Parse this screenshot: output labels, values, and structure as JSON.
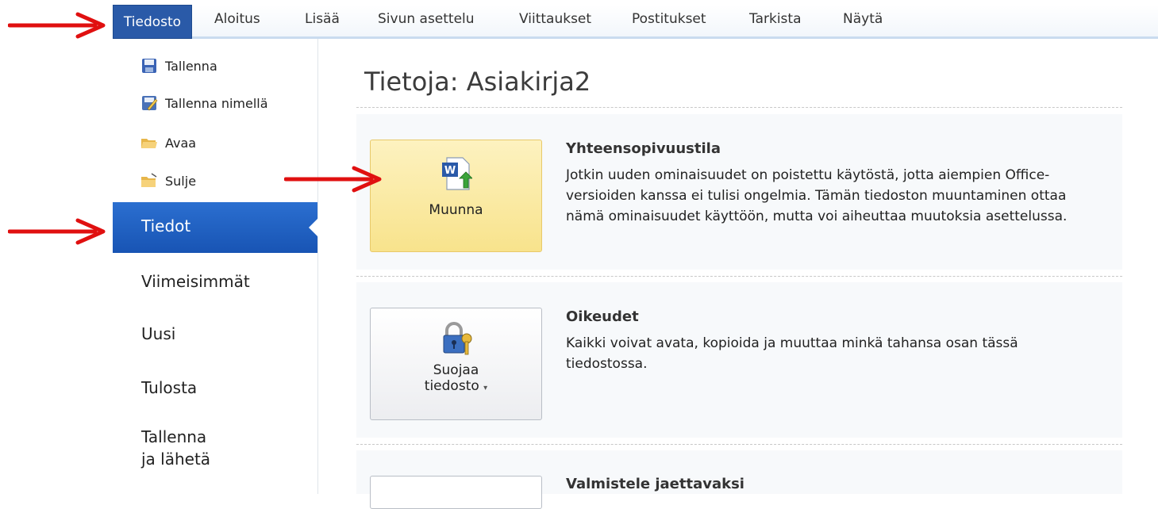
{
  "ribbon": {
    "tabs": [
      "Tiedosto",
      "Aloitus",
      "Lisää",
      "Sivun asettelu",
      "Viittaukset",
      "Postitukset",
      "Tarkista",
      "Näytä"
    ]
  },
  "sidebar": {
    "commands": [
      {
        "label": "Tallenna",
        "icon": "save-icon"
      },
      {
        "label": "Tallenna nimellä",
        "icon": "save-as-icon"
      },
      {
        "label": "Avaa",
        "icon": "open-folder-icon"
      },
      {
        "label": "Sulje",
        "icon": "close-folder-icon"
      }
    ],
    "active": "Tiedot",
    "nav": [
      "Viimeisimmät",
      "Uusi",
      "Tulosta",
      "Tallenna",
      "ja lähetä"
    ]
  },
  "main": {
    "title": "Tietoja: Asiakirja2",
    "sections": [
      {
        "button_label": "Muunna",
        "icon": "convert-document-icon",
        "title": "Yhteensopivuustila",
        "text": "Jotkin uuden ominaisuudet on poistettu käytöstä, jotta aiempien Office-versioiden kanssa ei tulisi ongelmia. Tämän tiedoston muuntaminen ottaa nämä ominaisuudet käyttöön, mutta voi aiheuttaa muutoksia asettelussa."
      },
      {
        "button_label_line1": "Suojaa",
        "button_label_line2": "tiedosto",
        "icon": "lock-key-icon",
        "title": "Oikeudet",
        "text": "Kaikki voivat avata, kopioida ja muuttaa minkä tahansa osan tässä tiedostossa."
      },
      {
        "title": "Valmistele jaettavaksi"
      }
    ]
  },
  "colors": {
    "file_tab": "#2a5aa8",
    "active_nav": "#1f63c6",
    "arrow": "#e01010",
    "highlight_button": "#f8e38c"
  }
}
